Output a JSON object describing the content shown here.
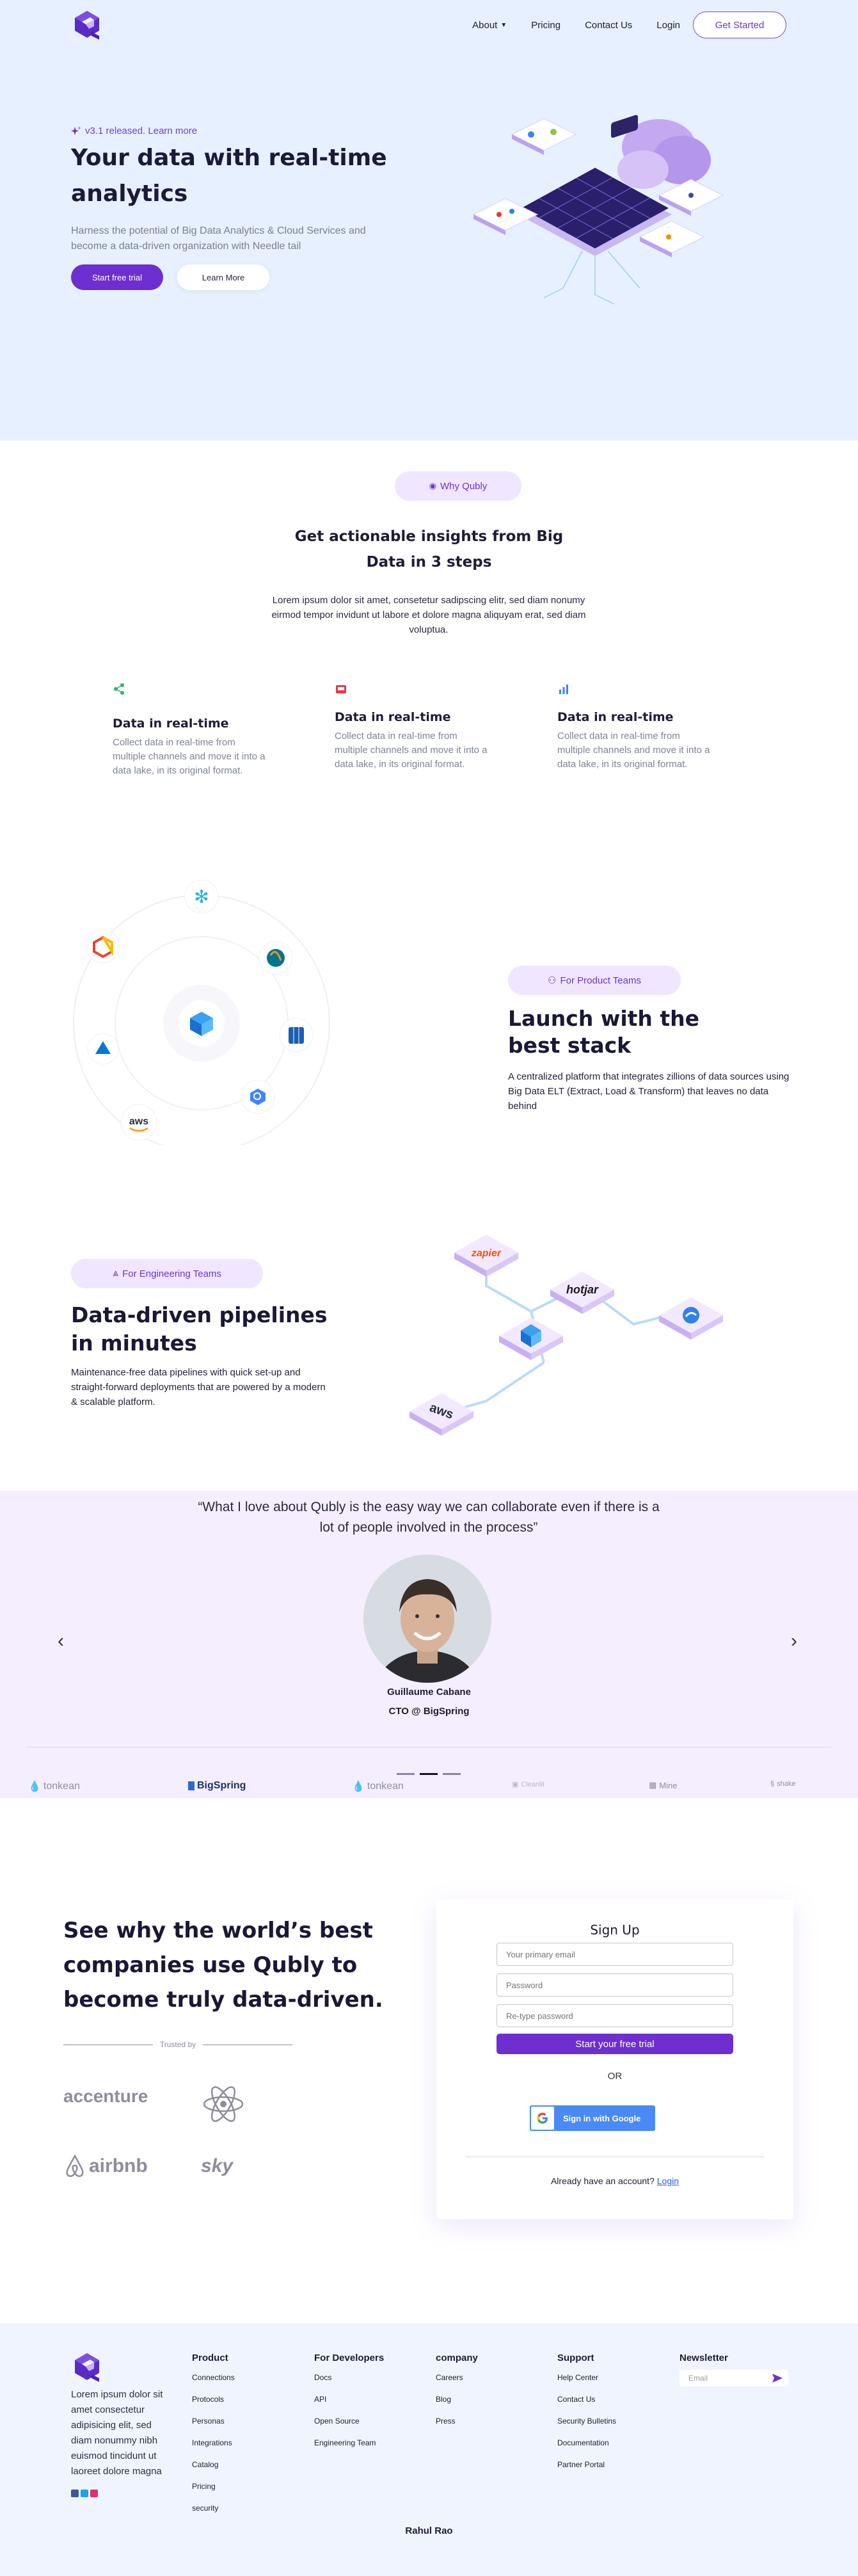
{
  "nav": {
    "about": "About",
    "pricing": "Pricing",
    "contact": "Contact Us",
    "login": "Login",
    "get_started": "Get Started"
  },
  "hero": {
    "release": "v3.1 released. Learn more",
    "title": "Your data with real-time analytics",
    "subtitle": "Harness the potential of Big Data Analytics & Cloud Services and become a data-driven organization with Needle tail",
    "primary_btn": "Start free trial",
    "secondary_btn": "Learn More"
  },
  "why": {
    "pill": "Why Qubly",
    "title_line1": "Get actionable insights from Big",
    "title_line2": "Data in 3 steps",
    "body": "Lorem ipsum dolor sit amet, consetetur sadipscing elitr, sed diam nonumy eirmod tempor invidunt ut labore et dolore magna aliquyam erat, sed diam voluptua.",
    "features": [
      {
        "title": "Data in real-time",
        "text": "Collect data in real-time from multiple channels and move it into a data lake, in its original format.",
        "icon": "share-icon"
      },
      {
        "title": "Data in real-time",
        "text": "Collect data in real-time from multiple channels and move it into a data lake, in its original format.",
        "icon": "inbox-icon"
      },
      {
        "title": "Data in real-time",
        "text": "Collect data in real-time from multiple channels and move it into a data lake, in its original format.",
        "icon": "bar-chart-icon"
      }
    ]
  },
  "product": {
    "pill": "For Product Teams",
    "title_line1": "Launch with the",
    "title_line2": "best stack",
    "text": "A centralized platform that integrates zillions of data sources using Big Data ELT (Extract, Load & Transform) that leaves no data behind",
    "aws_label": "aws"
  },
  "engineering": {
    "pill": "For Engineering Teams",
    "title_line1": "Data-driven pipelines",
    "title_line2": "in minutes",
    "text": "Maintenance-free data pipelines with quick set-up and straight-forward deployments that are powered by a modern & scalable platform.",
    "tiles": [
      "zapier",
      "hotjar",
      "aws"
    ]
  },
  "testimonial": {
    "quote": "“What I love about Qubly is the easy way we can collaborate even if there is a lot of people involved in the process”",
    "name": "Guillaume Cabane",
    "role": "CTO @ BigSpring",
    "prev": "‹",
    "next": "›",
    "logos": [
      "tonkean",
      "BigSpring",
      "tonkean",
      "Cleanlit",
      "Mine",
      "shake"
    ]
  },
  "signup": {
    "headline": "See why the world’s best companies use Qubly to become truly data-driven.",
    "trusted": "Trusted by",
    "brands": [
      "accenture",
      "airbnb",
      "sky"
    ],
    "card_title": "Sign Up",
    "email_ph": "Your primary email",
    "password_ph": "Password",
    "retype_ph": "Re-type password",
    "cta": "Start your free trial",
    "or": "OR",
    "google": "Sign in with Google",
    "have_account": "Already have an account?",
    "login": "Login"
  },
  "footer": {
    "about": "Lorem ipsum dolor sit amet consectetur adipisicing elit, sed diam nonummy nibh euismod tincidunt ut laoreet dolore magna",
    "columns": [
      {
        "title": "Product",
        "links": [
          "Connections",
          "Protocols",
          "Personas",
          "Integrations",
          "Catalog",
          "Pricing",
          "security"
        ]
      },
      {
        "title": "For Developers",
        "links": [
          "Docs",
          "API",
          "Open Source",
          "Engineering Team"
        ]
      },
      {
        "title": "company",
        "links": [
          "Careers",
          "Blog",
          "Press"
        ]
      },
      {
        "title": "Support",
        "links": [
          "Help Center",
          "Contact Us",
          "Security Bulletins",
          "Documentation",
          "Partner Portal"
        ]
      }
    ],
    "newsletter": "Newsletter",
    "email_ph": "Email",
    "author": "Rahul Rao",
    "colors": {
      "brand": "#6d2fcf",
      "hero_bg": "#e7f0fe",
      "testimonial_bg": "#f5eefe",
      "footer_bg": "#f0f4fe"
    }
  }
}
